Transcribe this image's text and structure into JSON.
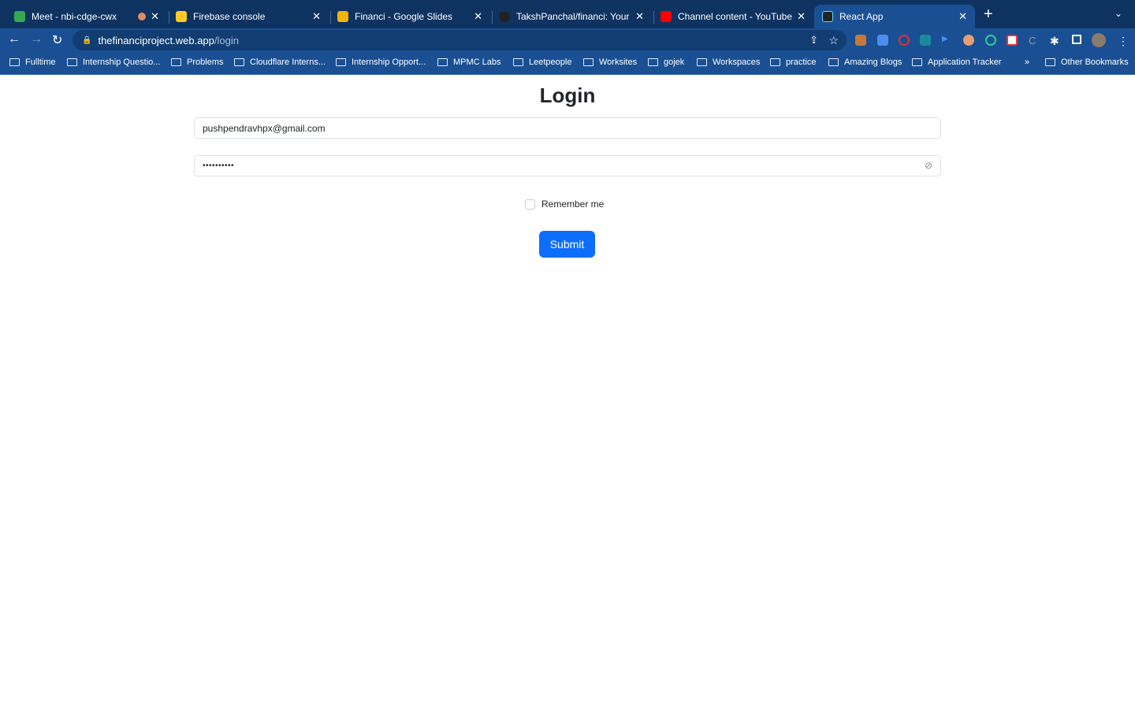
{
  "browser": {
    "tabs": [
      {
        "title": "Meet - nbi-cdge-cwx",
        "favicon": "google-meet-icon",
        "color": "#34a853",
        "active": false
      },
      {
        "title": "Firebase console",
        "favicon": "firebase-icon",
        "color": "#ffca28",
        "active": false
      },
      {
        "title": "Financi - Google Slides",
        "favicon": "google-slides-icon",
        "color": "#f4b400",
        "active": false
      },
      {
        "title": "TakshPanchal/financi: Your Per",
        "favicon": "github-icon",
        "color": "#222222",
        "active": false
      },
      {
        "title": "Channel content - YouTube Stu",
        "favicon": "youtube-icon",
        "color": "#ff0000",
        "active": false
      },
      {
        "title": "React App",
        "favicon": "react-icon",
        "color": "#61dafb",
        "active": true
      }
    ],
    "new_tab": "+",
    "url_host": "thefinanciproject.web.app",
    "url_path": "/login",
    "bookmarks": [
      "Fulltime",
      "Internship Questio...",
      "Problems",
      "Cloudflare Interns...",
      "Internship Opport...",
      "MPMC Labs",
      "Leetpeople",
      "Worksites",
      "gojek",
      "Workspaces",
      "practice",
      "Amazing Blogs",
      "Application Tracker"
    ],
    "bookmarks_overflow": "»",
    "other_bookmarks": "Other Bookmarks"
  },
  "page": {
    "title": "Login",
    "email_value": "pushpendravhpx@gmail.com",
    "password_value": "••••••••••",
    "remember_label": "Remember me",
    "remember_checked": false,
    "submit_label": "Submit",
    "accent": "#0d6efd"
  }
}
